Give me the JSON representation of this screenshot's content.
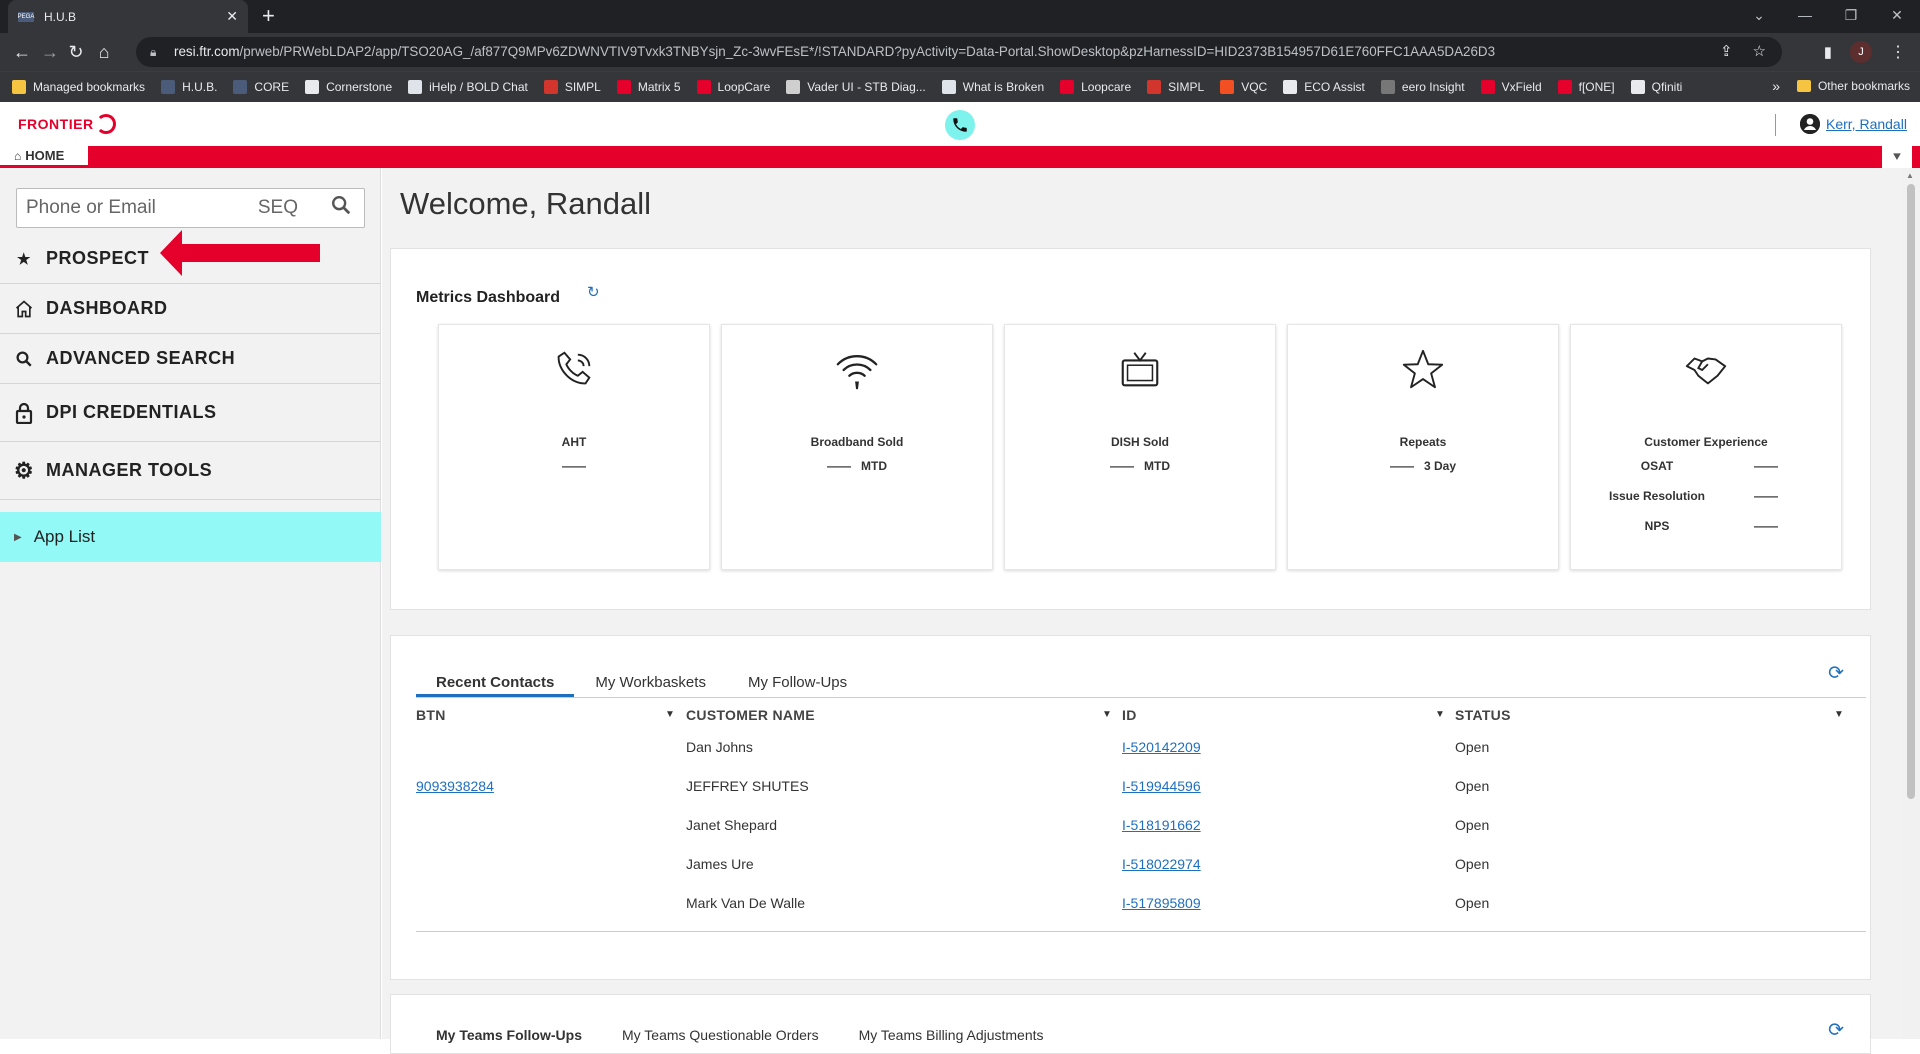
{
  "browser": {
    "tab_title": "H.U.B",
    "tab_favicon": "PEGA",
    "url_host": "resi.ftr.com",
    "url_path": "/prweb/PRWebLDAP2/app/TSO20AG_/af877Q9MPv6ZDWNVTIV9Tvxk3TNBYsjn_Zc-3wvFEsE*/!STANDARD?pyActivity=Data-Portal.ShowDesktop&pzHarnessID=HID2373B154957D61E760FFC1AAA5DA26D3",
    "profile_initial": "J",
    "bookmarks": [
      {
        "label": "Managed bookmarks",
        "color": "#f5c542"
      },
      {
        "label": "H.U.B.",
        "color": "#4b5b7a"
      },
      {
        "label": "CORE",
        "color": "#4b5b7a"
      },
      {
        "label": "Cornerstone",
        "color": "#e8eaed"
      },
      {
        "label": "iHelp / BOLD Chat",
        "color": "#dfe3ea"
      },
      {
        "label": "SIMPL",
        "color": "#d1352b"
      },
      {
        "label": "Matrix 5",
        "color": "#e4002b"
      },
      {
        "label": "LoopCare",
        "color": "#e4002b"
      },
      {
        "label": "Vader UI - STB Diag...",
        "color": "#cfcfcf"
      },
      {
        "label": "What is Broken",
        "color": "#dfe3ea"
      },
      {
        "label": "Loopcare",
        "color": "#e4002b"
      },
      {
        "label": "SIMPL",
        "color": "#d1352b"
      },
      {
        "label": "VQC",
        "color": "#f25022"
      },
      {
        "label": "ECO Assist",
        "color": "#e8eaed"
      },
      {
        "label": "eero Insight",
        "color": "#777777"
      },
      {
        "label": "VxField",
        "color": "#e4002b"
      },
      {
        "label": "f[ONE]",
        "color": "#e4002b"
      },
      {
        "label": "Qfiniti",
        "color": "#e8eaed"
      }
    ],
    "bookmarks_more": "»",
    "other_bookmarks": "Other bookmarks"
  },
  "header": {
    "logo_text": "FRONTIER",
    "user_name": "Kerr, Randall",
    "home_tab": "HOME"
  },
  "sidebar": {
    "search_placeholder": "Phone or Email",
    "search_seq": "SEQ",
    "items": [
      {
        "label": "PROSPECT",
        "icon": "star-icon"
      },
      {
        "label": "DASHBOARD",
        "icon": "home-icon"
      },
      {
        "label": "ADVANCED SEARCH",
        "icon": "search-icon"
      },
      {
        "label": "DPI CREDENTIALS",
        "icon": "lock-icon"
      },
      {
        "label": "MANAGER TOOLS",
        "icon": "gear-icon"
      }
    ],
    "app_list": "App List"
  },
  "main": {
    "welcome": "Welcome, Randall",
    "metrics_title": "Metrics Dashboard",
    "tiles": [
      {
        "label": "AHT",
        "value": "——",
        "suffix": "",
        "icon": "phone-icon"
      },
      {
        "label": "Broadband Sold",
        "value": "——",
        "suffix": "MTD",
        "icon": "wifi-icon"
      },
      {
        "label": "DISH Sold",
        "value": "——",
        "suffix": "MTD",
        "icon": "tv-icon"
      },
      {
        "label": "Repeats",
        "value": "——",
        "suffix": "3 Day",
        "icon": "star-outline-icon"
      },
      {
        "label": "Customer Experience",
        "icon": "handshake-icon",
        "rows": [
          {
            "key": "OSAT",
            "value": "——"
          },
          {
            "key": "Issue Resolution",
            "value": "——"
          },
          {
            "key": "NPS",
            "value": "——"
          }
        ]
      }
    ],
    "contacts_tabs": [
      "Recent Contacts",
      "My Workbaskets",
      "My Follow-Ups"
    ],
    "columns": [
      "BTN",
      "CUSTOMER NAME",
      "ID",
      "STATUS"
    ],
    "rows": [
      {
        "btn": "",
        "name": "Dan Johns",
        "id": "I-520142209",
        "status": "Open"
      },
      {
        "btn": "9093938284",
        "name": "JEFFREY SHUTES",
        "id": "I-519944596",
        "status": "Open"
      },
      {
        "btn": "",
        "name": "Janet Shepard",
        "id": "I-518191662",
        "status": "Open"
      },
      {
        "btn": "",
        "name": "James Ure",
        "id": "I-518022974",
        "status": "Open"
      },
      {
        "btn": "",
        "name": "Mark Van De Walle",
        "id": "I-517895809",
        "status": "Open"
      }
    ],
    "teams_tabs": [
      "My Teams Follow-Ups",
      "My Teams Questionable Orders",
      "My Teams Billing Adjustments"
    ]
  },
  "colors": {
    "brand_red": "#e4002b",
    "link_blue": "#1f6fbf",
    "accent_cyan": "#93f9f6"
  }
}
